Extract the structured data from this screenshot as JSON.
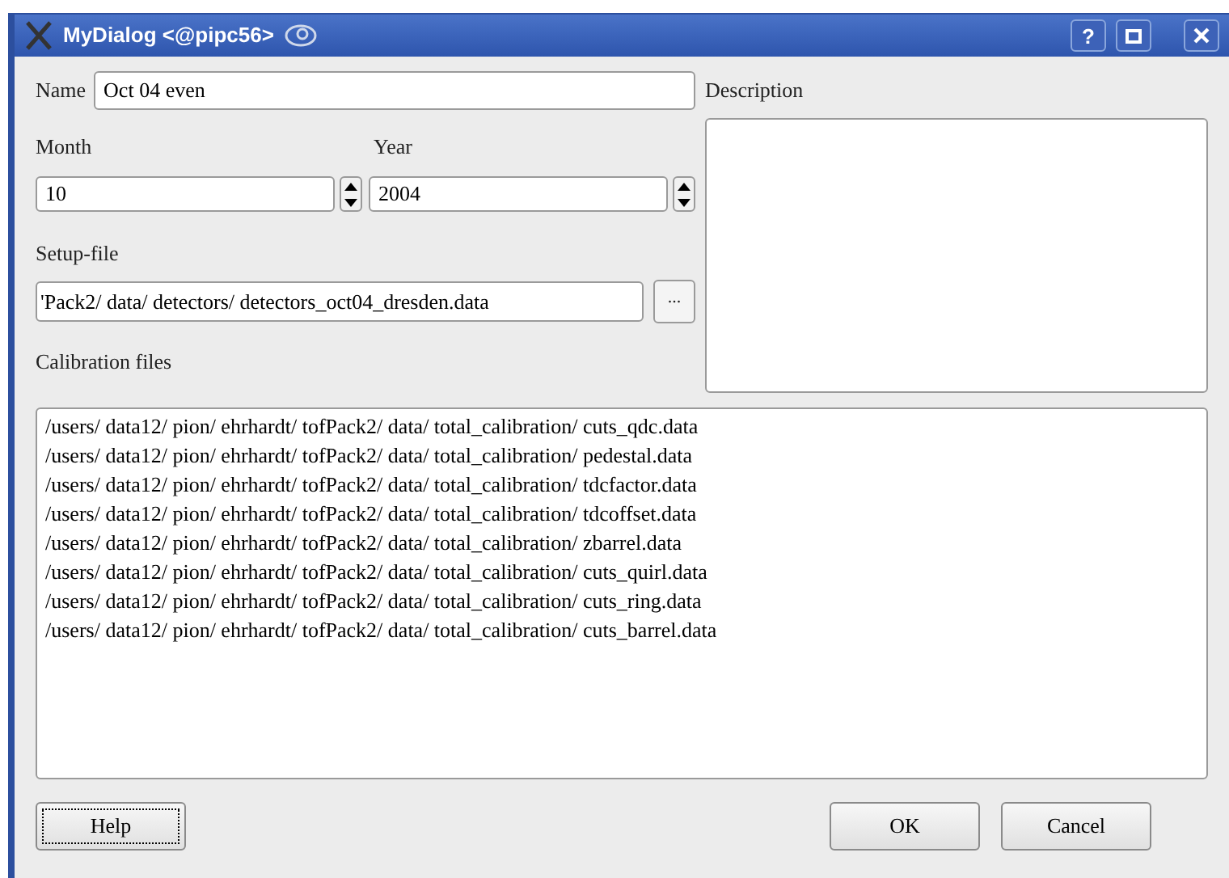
{
  "window": {
    "title": "MyDialog <@pipc56>",
    "title_buttons": [
      "?"
    ]
  },
  "name": {
    "label": "Name",
    "value": "Oct 04 even"
  },
  "description": {
    "label": "Description"
  },
  "month": {
    "label": "Month",
    "value": "10"
  },
  "year": {
    "label": "Year",
    "value": "2004"
  },
  "setup_file": {
    "label": "Setup-file",
    "value": "'Pack2/ data/ detectors/ detectors_oct04_dresden.data",
    "browse": "..."
  },
  "calibration": {
    "label": "Calibration files",
    "items": [
      "/users/ data12/ pion/ ehrhardt/ tofPack2/ data/ total_calibration/ cuts_qdc.data",
      "/users/ data12/ pion/ ehrhardt/ tofPack2/ data/ total_calibration/ pedestal.data",
      "/users/ data12/ pion/ ehrhardt/ tofPack2/ data/ total_calibration/ tdcfactor.data",
      "/users/ data12/ pion/ ehrhardt/ tofPack2/ data/ total_calibration/ tdcoffset.data",
      "/users/ data12/ pion/ ehrhardt/ tofPack2/ data/ total_calibration/ zbarrel.data",
      "/users/ data12/ pion/ ehrhardt/ tofPack2/ data/ total_calibration/ cuts_quirl.data",
      "/users/ data12/ pion/ ehrhardt/ tofPack2/ data/ total_calibration/ cuts_ring.data",
      "/users/ data12/ pion/ ehrhardt/ tofPack2/ data/ total_calibration/ cuts_barrel.data"
    ]
  },
  "buttons": [
    {
      "label": "Help",
      "focused": true
    },
    {
      "label": "OK",
      "focused": false
    },
    {
      "label": "Cancel",
      "focused": false
    }
  ]
}
